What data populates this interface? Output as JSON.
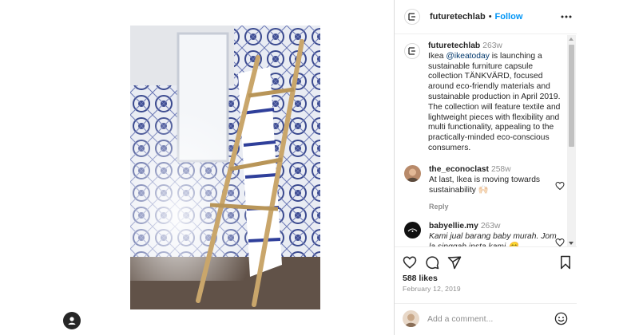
{
  "post": {
    "author": "futuretechlab",
    "follow_label": "Follow",
    "dot": "•"
  },
  "caption": {
    "username": "futuretechlab",
    "time": "263w",
    "text_before": "Ikea ",
    "mention": "@ikeatoday",
    "text_after": " is launching a sustainable furniture capsule collection TÄNKVÄRD, focused around eco-friendly materials and sustainable production in April 2019. The collection will feature textile and lightweight pieces with flexibility and multi functionality, appealing to the practically-minded eco-conscious consumers."
  },
  "comments": [
    {
      "username": "the_econoclast",
      "time": "258w",
      "text": "At last, Ikea is moving towards sustainability 🙌🏻",
      "reply_label": "Reply"
    },
    {
      "username": "babyellie.my",
      "time": "263w",
      "text": "Kami jual barang baby murah. Jom la singgah insta kami 😊"
    }
  ],
  "engagement": {
    "likes": "588 likes",
    "date": "February 12, 2019"
  },
  "comment_box": {
    "placeholder": "Add a comment..."
  },
  "icons": {
    "more": "more-horizontal-icon",
    "like": "heart-icon",
    "comment": "comment-bubble-icon",
    "share": "paper-plane-icon",
    "save": "bookmark-icon",
    "emoji": "smiley-icon"
  },
  "colors": {
    "link": "#0095f6",
    "mention": "#00376b",
    "muted": "#8e8e8e"
  }
}
